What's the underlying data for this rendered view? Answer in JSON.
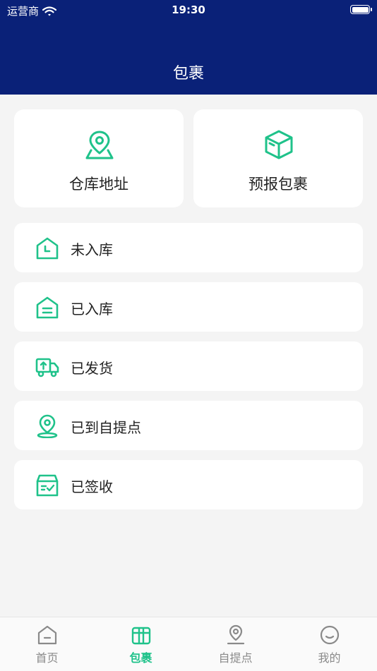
{
  "status_bar": {
    "carrier": "运营商",
    "time": "19:30"
  },
  "header": {
    "title": "包裹"
  },
  "top_cards": [
    {
      "label": "仓库地址",
      "icon": "warehouse-location-icon"
    },
    {
      "label": "预报包裹",
      "icon": "package-box-icon"
    }
  ],
  "statuses": [
    {
      "label": "未入库",
      "icon": "house-clock-icon"
    },
    {
      "label": "已入库",
      "icon": "house-stored-icon"
    },
    {
      "label": "已发货",
      "icon": "truck-icon"
    },
    {
      "label": "已到自提点",
      "icon": "pickup-location-icon"
    },
    {
      "label": "已签收",
      "icon": "signed-box-icon"
    }
  ],
  "tabbar": {
    "items": [
      {
        "label": "首页",
        "icon": "home-icon",
        "active": false
      },
      {
        "label": "包裹",
        "icon": "parcel-icon",
        "active": true
      },
      {
        "label": "自提点",
        "icon": "pickup-point-icon",
        "active": false
      },
      {
        "label": "我的",
        "icon": "smiley-icon",
        "active": false
      }
    ]
  },
  "colors": {
    "header_bg": "#0a2178",
    "accent": "#1fc28a",
    "inactive": "#8a8a8a",
    "page_bg": "#f4f4f4"
  }
}
